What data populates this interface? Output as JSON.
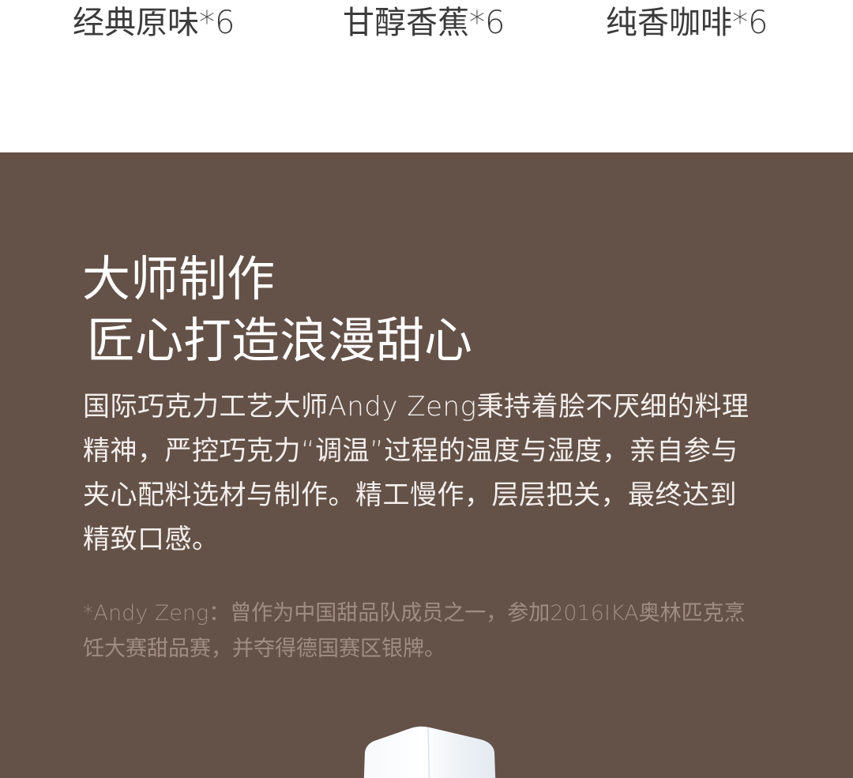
{
  "flavors": [
    "经典原味*6",
    "甘醇香蕉*6",
    "纯香咖啡*6"
  ],
  "master": {
    "title_line1": "大师制作",
    "title_line2": "匠心打造浪漫甜心",
    "body": "国际巧克力工艺大师Andy Zeng秉持着脍不厌细的料理精神，严控巧克力“调温”过程的温度与湿度，亲自参与夹心配料选材与制作。精工慢作，层层把关，最终达到精致口感。",
    "note": "*Andy Zeng：曾作为中国甜品队成员之一，参加2016IKA奥林匹克烹饪大赛甜品赛，并夺得德国赛区银牌。"
  },
  "colors": {
    "section_bg": "#645249",
    "title": "#ffffff",
    "note": "#a08d82"
  }
}
